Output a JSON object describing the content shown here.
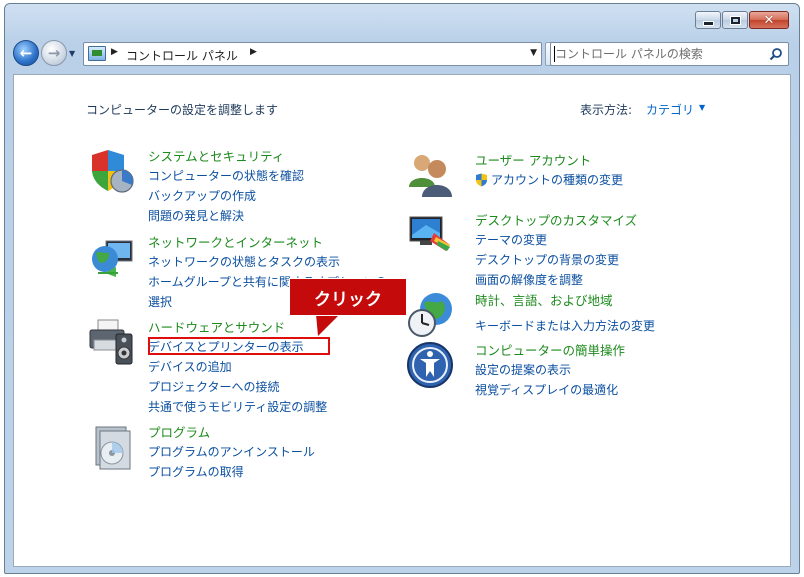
{
  "window": {
    "caption": {
      "minimize": "─",
      "maximize": "□",
      "close": "✕"
    }
  },
  "navbar": {
    "crumb": "コントロール パネル",
    "search_placeholder": "コントロール パネルの検索"
  },
  "page": {
    "title": "コンピューターの設定を調整します",
    "view_label": "表示方法:",
    "view_value": "カテゴリ"
  },
  "categories": {
    "system": {
      "title": "システムとセキュリティ",
      "links": [
        "コンピューターの状態を確認",
        "バックアップの作成",
        "問題の発見と解決"
      ]
    },
    "network": {
      "title": "ネットワークとインターネット",
      "links": [
        "ネットワークの状態とタスクの表示",
        "ホームグループと共有に関するオプションの",
        "選択"
      ]
    },
    "hardware": {
      "title": "ハードウェアとサウンド",
      "links": [
        "デバイスとプリンターの表示",
        "デバイスの追加",
        "プロジェクターへの接続",
        "共通で使うモビリティ設定の調整"
      ]
    },
    "programs": {
      "title": "プログラム",
      "links": [
        "プログラムのアンインストール",
        "プログラムの取得"
      ]
    },
    "users": {
      "title": "ユーザー アカウント",
      "links": [
        "アカウントの種類の変更"
      ]
    },
    "appearance": {
      "title": "デスクトップのカスタマイズ",
      "links": [
        "テーマの変更",
        "デスクトップの背景の変更",
        "画面の解像度を調整"
      ]
    },
    "clock": {
      "title": "時計、言語、および地域",
      "links": [
        "キーボードまたは入力方法の変更"
      ]
    },
    "ease": {
      "title": "コンピューターの簡単操作",
      "links": [
        "設定の提案の表示",
        "視覚ディスプレイの最適化"
      ]
    }
  },
  "annotation": {
    "callout": "クリック"
  },
  "colors": {
    "link": "#0b4fa0",
    "category_title": "#1c8a1c",
    "annotation_red": "#c40a0a"
  }
}
